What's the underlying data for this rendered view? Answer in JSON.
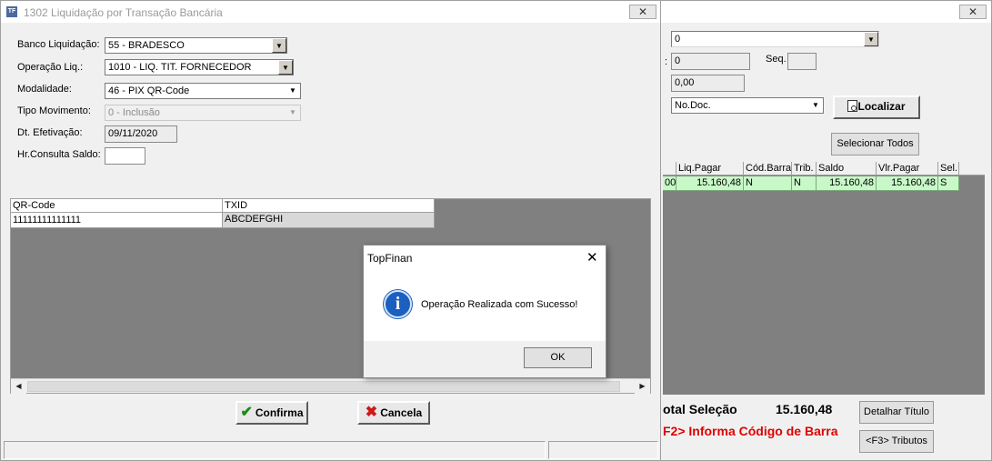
{
  "main_window": {
    "title": "1302 Liquidação por Transação Bancária",
    "close_symbol": "✕",
    "form": {
      "banco_label": "Banco Liquidação:",
      "banco_value": "55 - BRADESCO",
      "operacao_label": "Operação Liq.:",
      "operacao_value": "1010 - LIQ. TIT. FORNECEDOR",
      "modalidade_label": "Modalidade:",
      "modalidade_value": "46 - PIX QR-Code",
      "tipo_label": "Tipo Movimento:",
      "tipo_value": "0 - Inclusão",
      "dt_label": "Dt. Efetivação:",
      "dt_value": "09/11/2020",
      "hr_label": "Hr.Consulta Saldo:",
      "hr_value": ""
    },
    "grid": {
      "headers": [
        "QR-Code",
        "TXID"
      ],
      "row": [
        "11111111111111",
        "ABCDEFGHI"
      ]
    },
    "confirma_label": "Confirma",
    "cancela_label": "Cancela"
  },
  "back_window": {
    "close_symbol": "✕",
    "combo_top_value": "0",
    "field_a_prefix": ":",
    "field_a_value": "0",
    "seq_label": "Seq.",
    "seq_value": "",
    "field_b_value": "0,00",
    "order_value": "No.Doc.",
    "localizar_label": "Localizar",
    "selecionar_label": "Selecionar Todos",
    "grid": {
      "headers": [
        "",
        "Liq.Pagar",
        "Cód.Barra",
        "Trib.",
        "Saldo",
        "Vlr.Pagar",
        "Sel."
      ],
      "row": [
        "00",
        "15.160,48",
        "N",
        "N",
        "15.160,48",
        "15.160,48",
        "S"
      ]
    },
    "total_label": "otal Seleção",
    "total_value": "15.160,48",
    "f2_text": "F2> Informa Código de Barra",
    "detalhar_label": "Detalhar Título",
    "tributos_label": "<F3> Tributos"
  },
  "dialog": {
    "title": "TopFinan",
    "close_symbol": "✕",
    "message": "Operação Realizada com Sucesso!",
    "info_symbol": "i",
    "ok_label": "OK"
  },
  "colors": {
    "grid_gray": "#808080",
    "selected_row": "#c8f8c8",
    "f2_red": "#e00000",
    "info_blue": "#1b5fbf"
  }
}
